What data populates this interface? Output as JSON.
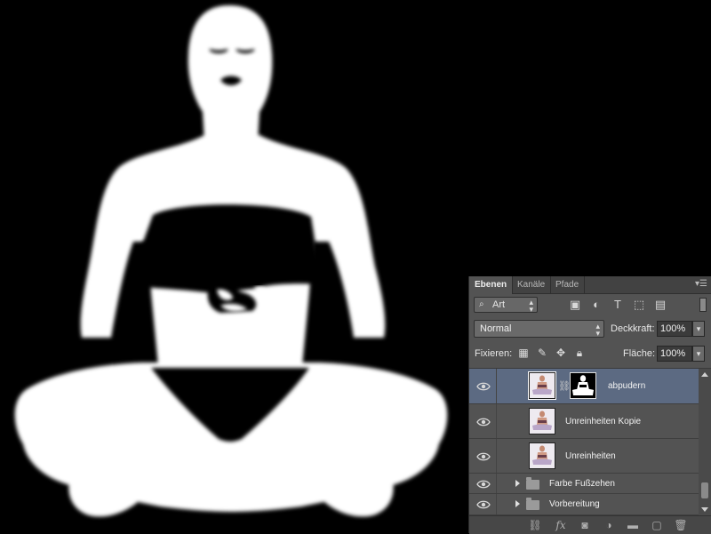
{
  "panel": {
    "tabs": [
      {
        "label": "Ebenen"
      },
      {
        "label": "Kanäle"
      },
      {
        "label": "Pfade"
      }
    ],
    "filter": {
      "kind_value": "Art"
    },
    "blend_mode": {
      "value": "Normal"
    },
    "opacity": {
      "label": "Deckkraft:",
      "value": "100%"
    },
    "lock": {
      "label": "Fixieren:"
    },
    "fill": {
      "label": "Fläche:",
      "value": "100%"
    },
    "layers": [
      {
        "name": "abpudern",
        "selected": true,
        "has_mask": true
      },
      {
        "name": "Unreinheiten Kopie",
        "selected": false
      },
      {
        "name": "Unreinheiten",
        "selected": false
      },
      {
        "name": "Farbe Fußzehen",
        "type": "group"
      },
      {
        "name": "Vorbereitung",
        "type": "group"
      }
    ]
  },
  "colors": {
    "panel_bg": "#535353",
    "selected_layer": "#5c6a82",
    "canvas_bg": "#000000",
    "mask_white": "#ffffff"
  }
}
